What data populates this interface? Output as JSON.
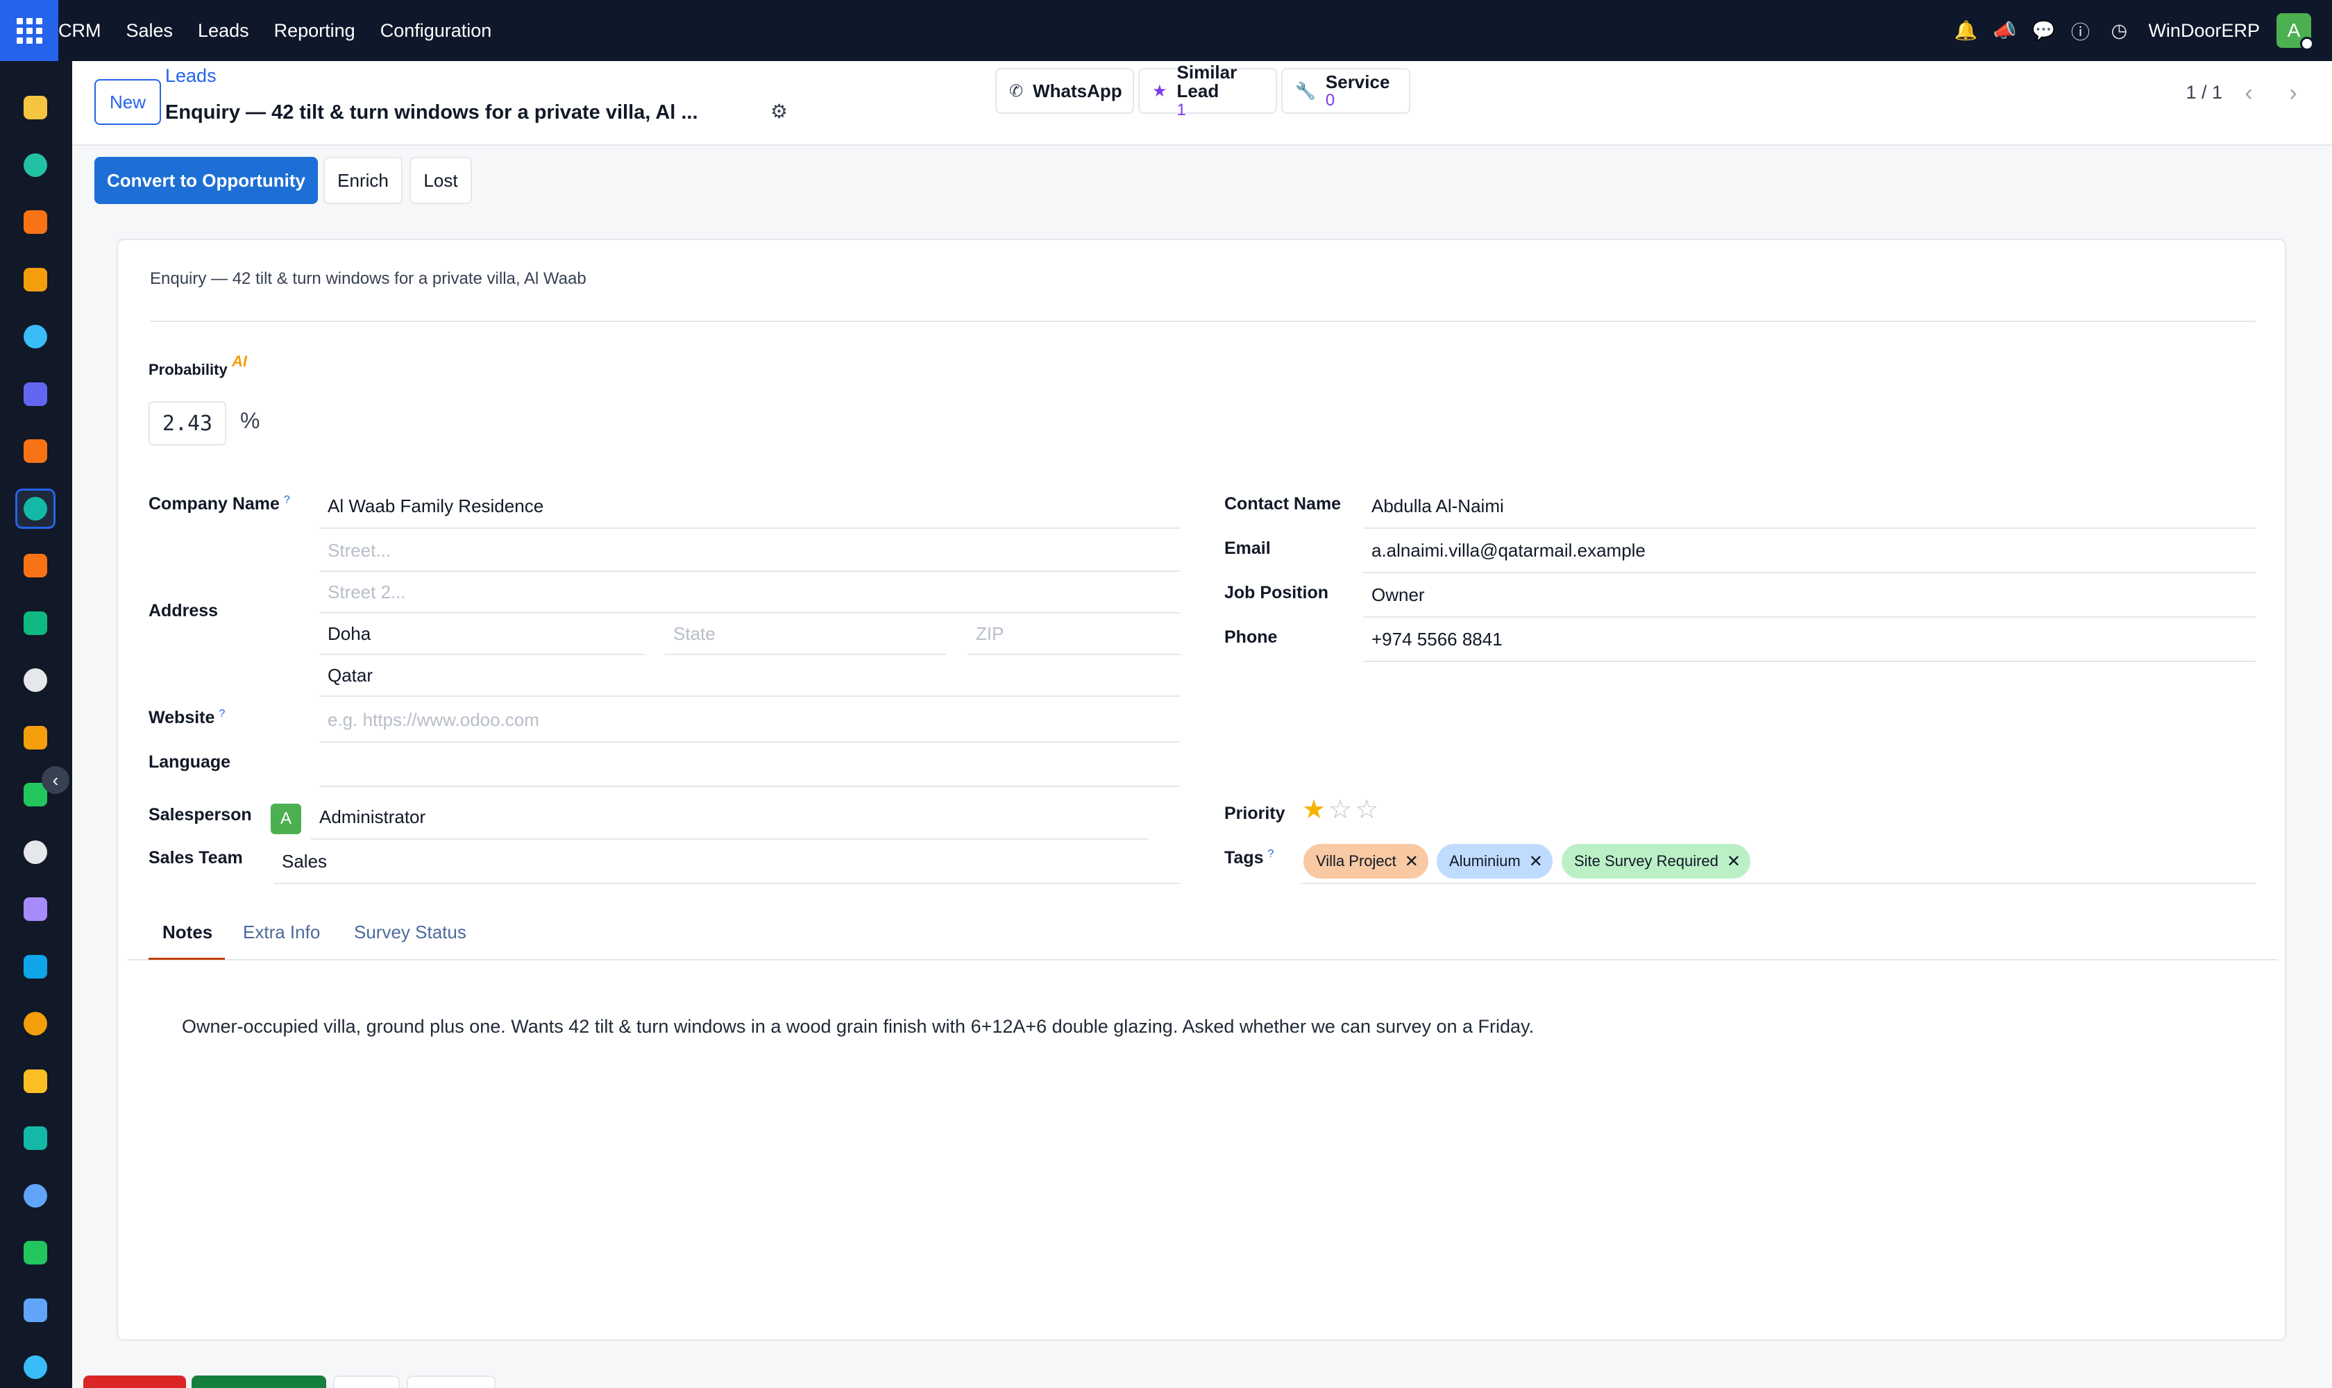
{
  "topbar": {
    "menu": [
      "CRM",
      "Sales",
      "Leads",
      "Reporting",
      "Configuration"
    ],
    "icons": [
      "bell-icon",
      "megaphone-icon",
      "chat-icon",
      "help-icon",
      "clock-icon"
    ],
    "company": "WinDoorERP",
    "avatar_letter": "A"
  },
  "sidebar": {
    "apps": [
      {
        "name": "send-app-icon",
        "color": "#f5c542"
      },
      {
        "name": "dashboard-app-icon",
        "color": "#22c1a3"
      },
      {
        "name": "inventory-app-icon",
        "color": "#f97316"
      },
      {
        "name": "reporting-app-icon",
        "color": "#f59e0b"
      },
      {
        "name": "discuss-app-icon",
        "color": "#38bdf8"
      },
      {
        "name": "email-app-icon",
        "color": "#6366f1"
      },
      {
        "name": "live-chat-app-icon",
        "color": "#f97316"
      },
      {
        "name": "crm-app-icon",
        "color": "#14b8a6"
      },
      {
        "name": "sales-app-icon",
        "color": "#f97316"
      },
      {
        "name": "contacts-app-icon",
        "color": "#10b981"
      },
      {
        "name": "products-app-icon",
        "color": "#e5e7eb"
      },
      {
        "name": "marketing-app-icon",
        "color": "#f59e0b"
      },
      {
        "name": "tasks-app-icon",
        "color": "#22c55e"
      },
      {
        "name": "knowledge-app-icon",
        "color": "#e5e7eb"
      },
      {
        "name": "purchase-app-icon",
        "color": "#a78bfa"
      },
      {
        "name": "invoicing-app-icon",
        "color": "#0ea5e9"
      },
      {
        "name": "employees-app-icon",
        "color": "#f59e0b"
      },
      {
        "name": "calendar-app-icon",
        "color": "#fbbf24"
      },
      {
        "name": "sign-app-icon",
        "color": "#14b8a6"
      },
      {
        "name": "apps-app-icon",
        "color": "#60a5fa"
      },
      {
        "name": "whatsapp-app-icon",
        "color": "#22c55e"
      },
      {
        "name": "timesheet-app-icon",
        "color": "#60a5fa"
      },
      {
        "name": "website-app-icon",
        "color": "#38bdf8"
      }
    ]
  },
  "control": {
    "new_label": "New",
    "breadcrumb": "Leads",
    "title": "Enquiry — 42 tilt & turn windows for a private villa, Al ...",
    "smart_buttons": [
      {
        "label": "WhatsApp",
        "icon": "whatsapp-icon"
      },
      {
        "label": "Similar Lead",
        "count": "1",
        "icon": "star-icon"
      },
      {
        "label": "Service",
        "count": "0",
        "icon": "wrench-icon"
      }
    ],
    "pager": "1 / 1"
  },
  "actions": {
    "convert": "Convert to Opportunity",
    "enrich": "Enrich",
    "lost": "Lost"
  },
  "form": {
    "lead_name": "Enquiry — 42 tilt & turn windows for a private villa, Al Waab",
    "probability_label": "Probability",
    "ai_badge": "AI",
    "probability": "2.43",
    "percent": "%",
    "company_name_label": "Company Name",
    "company_name": "Al Waab Family Residence",
    "address_label": "Address",
    "street_placeholder": "Street...",
    "street2_placeholder": "Street 2...",
    "city": "Doha",
    "state_placeholder": "State",
    "zip_placeholder": "ZIP",
    "country": "Qatar",
    "website_label": "Website",
    "website_placeholder": "e.g. https://www.odoo.com",
    "language_label": "Language",
    "language": "",
    "salesperson_label": "Salesperson",
    "salesperson_avatar": "A",
    "salesperson": "Administrator",
    "sales_team_label": "Sales Team",
    "sales_team": "Sales",
    "contact_name_label": "Contact Name",
    "contact_name": "Abdulla Al-Naimi",
    "email_label": "Email",
    "email": "a.alnaimi.villa@qatarmail.example",
    "job_position_label": "Job Position",
    "job_position": "Owner",
    "phone_label": "Phone",
    "phone": "+974 5566 8841",
    "priority_label": "Priority",
    "priority_stars": 1,
    "priority_max": 3,
    "tags_label": "Tags",
    "tags": [
      {
        "label": "Villa Project",
        "color": "#f8c9a3"
      },
      {
        "label": "Aluminium",
        "color": "#bfdbfe"
      },
      {
        "label": "Site Survey Required",
        "color": "#bbf0c6"
      }
    ],
    "help_marker": "?"
  },
  "tabs": [
    {
      "label": "Notes",
      "active": true
    },
    {
      "label": "Extra Info",
      "active": false
    },
    {
      "label": "Survey Status",
      "active": false
    }
  ],
  "notes": "Owner-occupied villa, ground plus one. Wants 42 tilt & turn windows in a wood grain finish with 6+12A+6 double glazing. Asked whether we can survey on a Friday.",
  "colors": {
    "accent": "#1d6fd6",
    "topbar": "#0f172a",
    "sidebar": "#111827"
  }
}
